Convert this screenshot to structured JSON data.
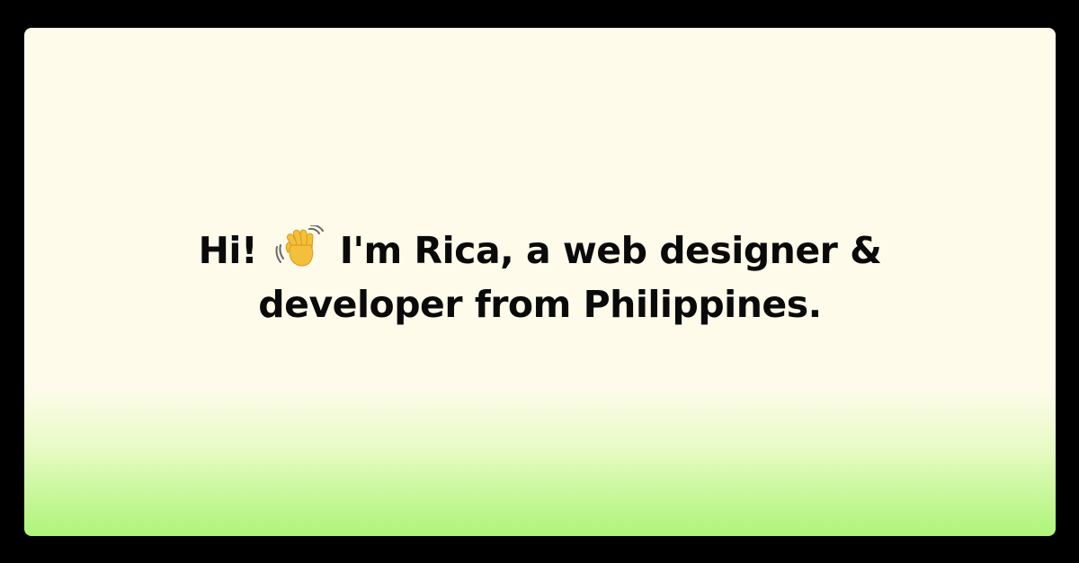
{
  "headline": {
    "line1_before": "Hi!",
    "wave_icon": "waving-hand-icon",
    "line1_after": "I'm Rica, a web designer &",
    "line2": "developer from Philippines."
  },
  "colors": {
    "frame": "#000000",
    "card_top": "#fefbea",
    "card_bottom": "#adf57a",
    "text": "#0a0a0a",
    "hand": "#f4bf3a"
  }
}
